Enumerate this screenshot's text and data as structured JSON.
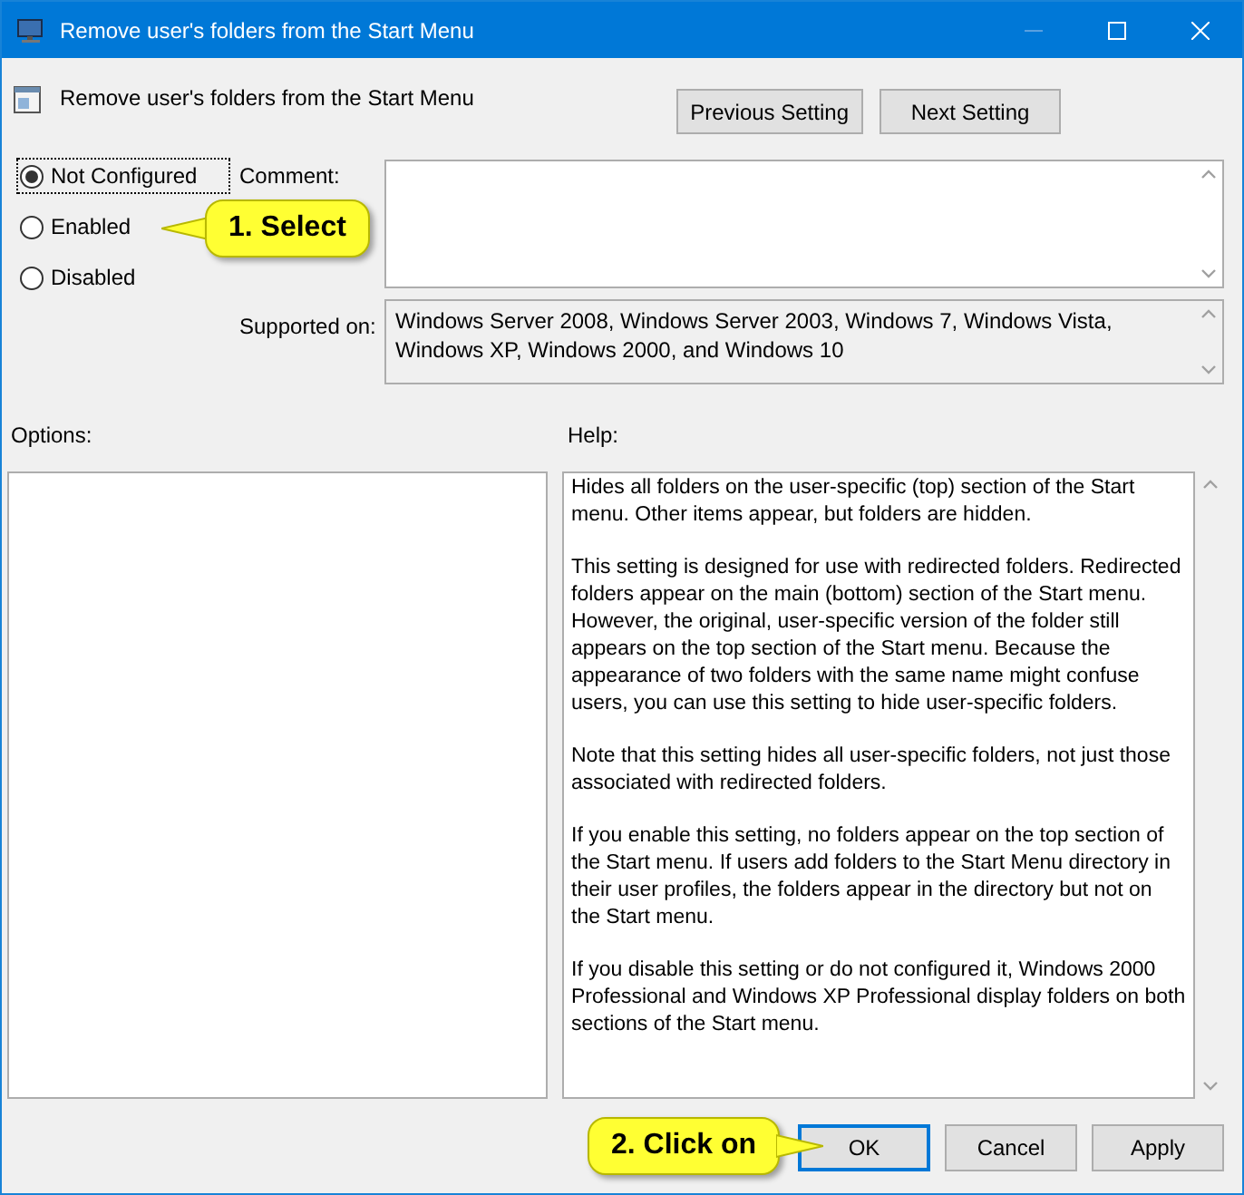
{
  "window": {
    "title": "Remove user's folders from the Start Menu"
  },
  "header": {
    "title": "Remove user's folders from the Start Menu",
    "buttons": [
      "Previous Setting",
      "Next Setting"
    ]
  },
  "states": [
    {
      "label": "Not Configured",
      "selected": true
    },
    {
      "label": "Enabled",
      "selected": false
    },
    {
      "label": "Disabled",
      "selected": false
    }
  ],
  "comment": {
    "label": "Comment:"
  },
  "supported_on": {
    "label": "Supported on:",
    "value": "Windows Server 2008, Windows Server 2003, Windows 7, Windows Vista, Windows XP, Windows 2000, and Windows 10"
  },
  "options": {
    "label": "Options:"
  },
  "help": {
    "label": "Help:",
    "paragraphs": [
      "Hides all folders on the user-specific (top) section of the Start menu. Other items appear, but folders are hidden.",
      "This setting is designed for use with redirected folders. Redirected folders appear on the main (bottom) section of the Start menu. However, the original, user-specific version of the folder still appears on the top section of the Start menu. Because the appearance of two folders with the same name might confuse users, you can use this setting to hide user-specific folders.",
      "Note that this setting hides all user-specific folders, not just those associated with redirected folders.",
      "If you enable this setting, no folders appear on the top section of the Start menu. If users add folders to the Start Menu directory in their user profiles, the folders appear in the directory but not on the Start menu.",
      "If you disable this setting or do not configured it, Windows 2000 Professional and Windows XP Professional display folders on both sections of the Start menu."
    ]
  },
  "footer_buttons": [
    {
      "label": "OK",
      "selected": true
    },
    {
      "label": "Cancel",
      "selected": false
    },
    {
      "label": "Apply",
      "selected": false
    }
  ],
  "callouts": [
    "1. Select",
    "2. Click on"
  ]
}
